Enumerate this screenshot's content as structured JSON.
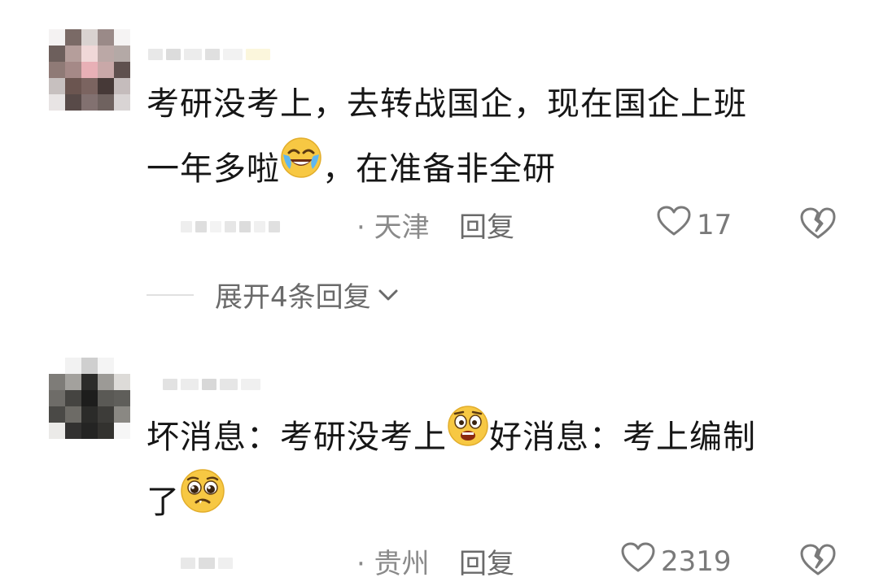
{
  "comments": [
    {
      "text_line1": "考研没考上，去转战国企，现在国企上班",
      "text_line2_a": "一年多啦",
      "text_line2_b": "，在准备非全研",
      "emoji": "crying-laughing-emoji",
      "location": "· 天津",
      "reply_label": "回复",
      "likes": "17",
      "expand_label": "展开4条回复"
    },
    {
      "text_line1_a": "坏消息：考研没考上",
      "text_line1_b": "好消息：考上编制",
      "text_line2": "了",
      "emoji1": "scared-face-emoji",
      "emoji2": "pleading-face-emoji",
      "location": "· 贵州",
      "reply_label": "回复",
      "likes": "2319"
    }
  ],
  "icons": {
    "like": "heart-outline-icon",
    "dislike": "broken-heart-icon",
    "expand": "chevron-down-icon"
  },
  "colors": {
    "text": "#161616",
    "meta": "#8a8a8a",
    "emoji_yellow": "#f7c843"
  }
}
